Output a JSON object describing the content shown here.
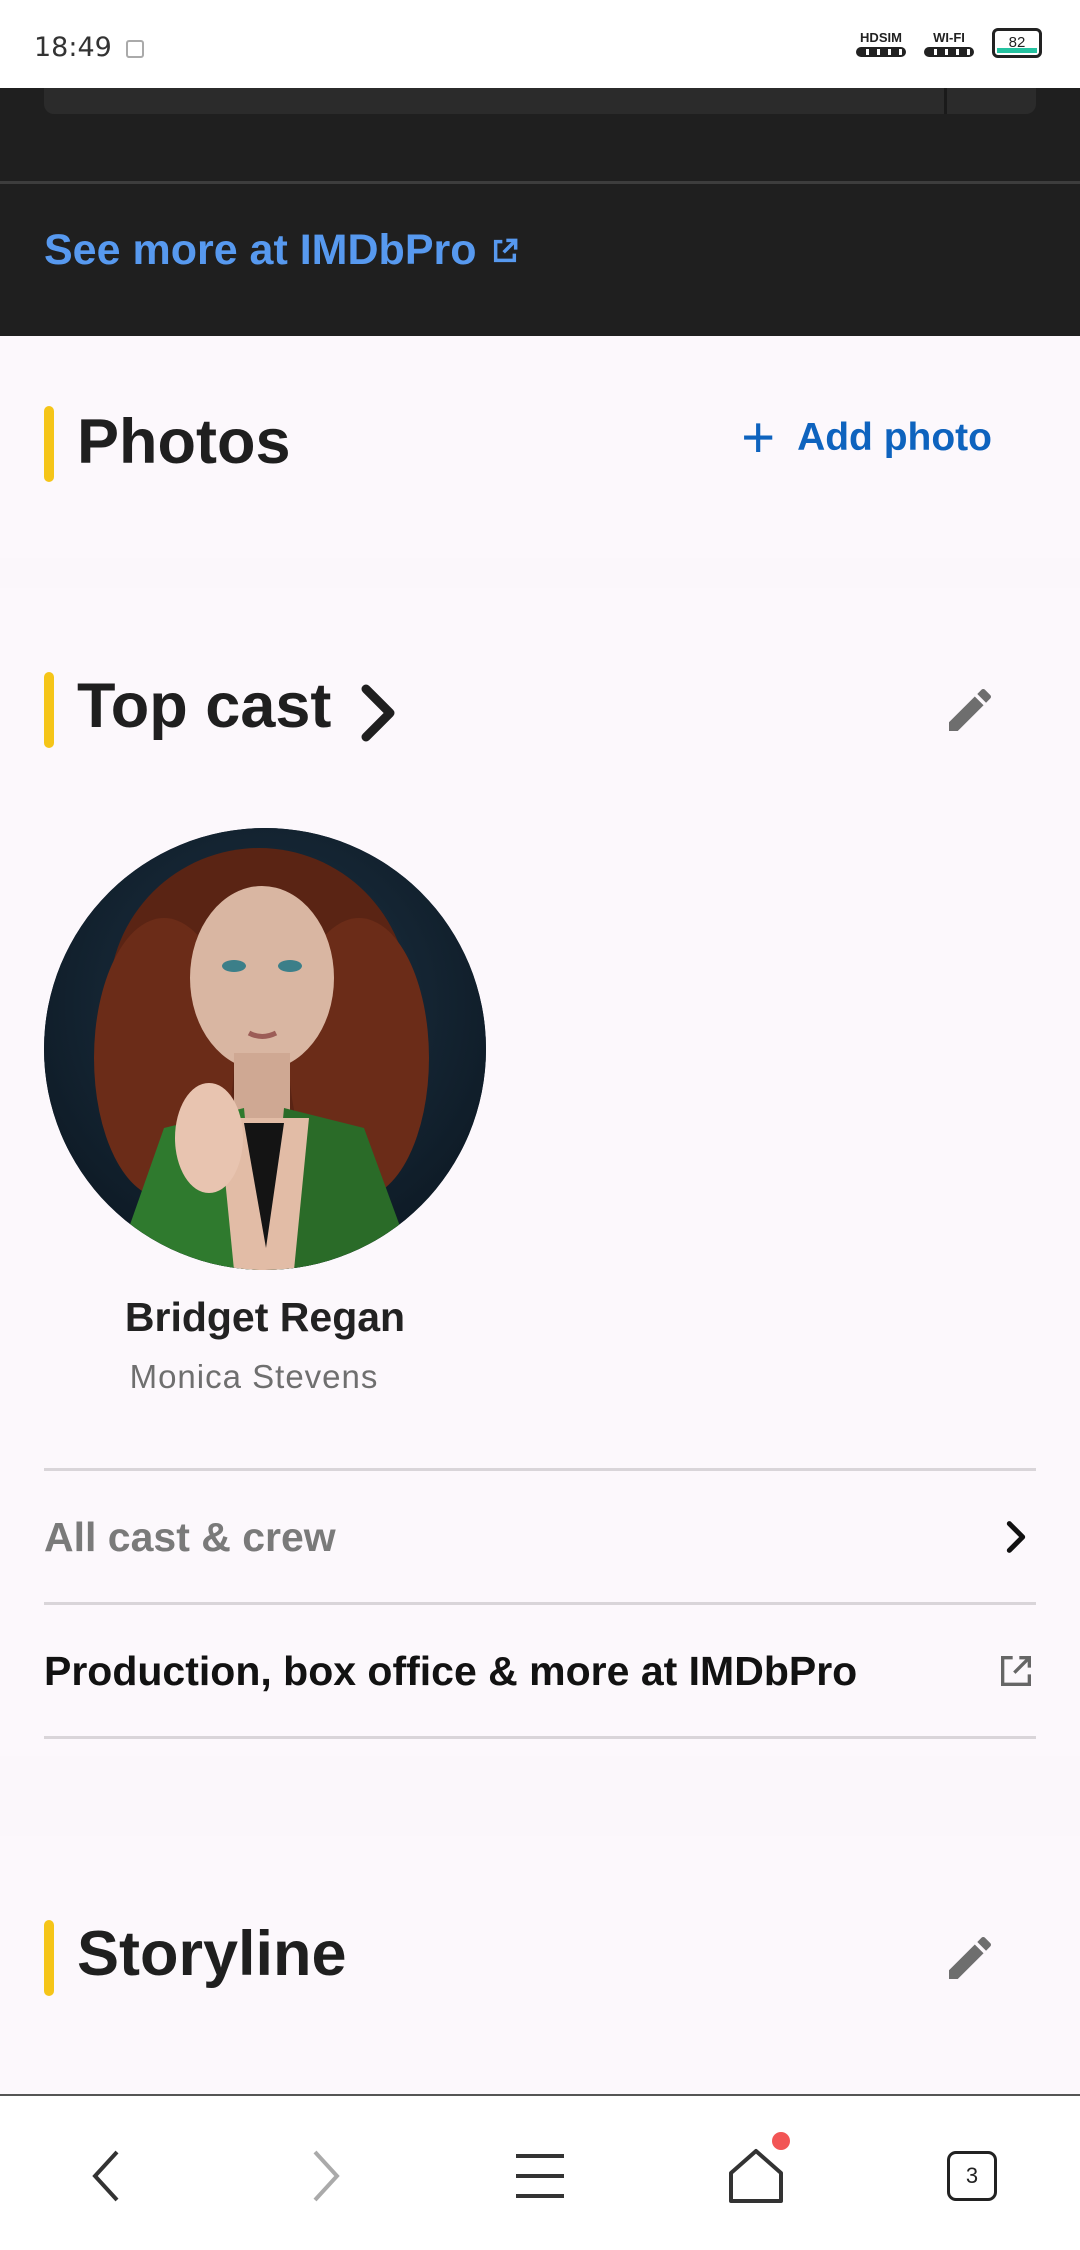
{
  "status": {
    "time": "18:49",
    "sim_label": "HDSIM",
    "wifi_label": "WI-FI",
    "battery": "82"
  },
  "imdbpro": {
    "link_label": "See more at IMDbPro"
  },
  "photos": {
    "title": "Photos",
    "add_label": "Add photo"
  },
  "cast": {
    "title": "Top cast",
    "members": [
      {
        "name": "Bridget Regan",
        "role": "Monica Stevens"
      }
    ],
    "all_link": "All cast & crew",
    "pro_link": "Production, box office & more at IMDbPro"
  },
  "storyline": {
    "title": "Storyline"
  },
  "nav": {
    "tab_count": "3"
  },
  "colors": {
    "accent": "#f5c518",
    "link_blue": "#0e63be",
    "pro_blue": "#5799ef",
    "dark_bg": "#1f1f1f"
  }
}
